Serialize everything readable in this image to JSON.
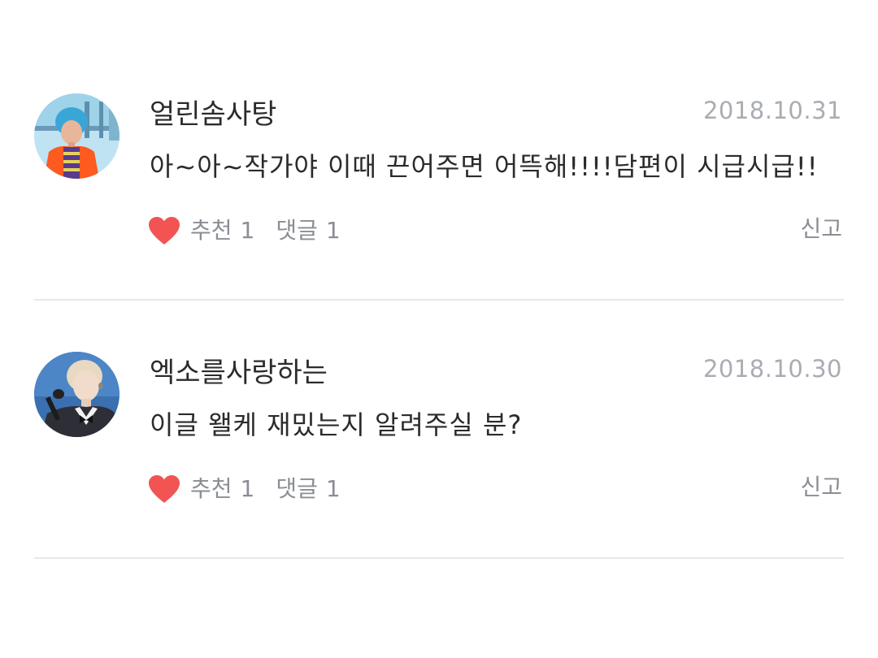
{
  "comments": [
    {
      "username": "얼린솜사탕",
      "date": "2018.10.31",
      "content": "아~아~작가야 이때 끈어주면 어뜩해!!!!담편이 시급시급!!",
      "like_label": "추천",
      "like_count": "1",
      "reply_label": "댓글",
      "reply_count": "1",
      "report_label": "신고",
      "avatar_icon": "avatar-photo"
    },
    {
      "username": "엑소를사랑하는",
      "date": "2018.10.30",
      "content": "이글 왤케 재밌는지 알려주실 분?",
      "like_label": "추천",
      "like_count": "1",
      "reply_label": "댓글",
      "reply_count": "1",
      "report_label": "신고",
      "avatar_icon": "avatar-photo"
    }
  ],
  "colors": {
    "heart": "#f25454",
    "text_primary": "#2b2b2b",
    "text_secondary": "#8a8e94",
    "date": "#a9adb3",
    "divider": "#e6e7e9"
  },
  "icons": {
    "like": "heart-icon"
  }
}
